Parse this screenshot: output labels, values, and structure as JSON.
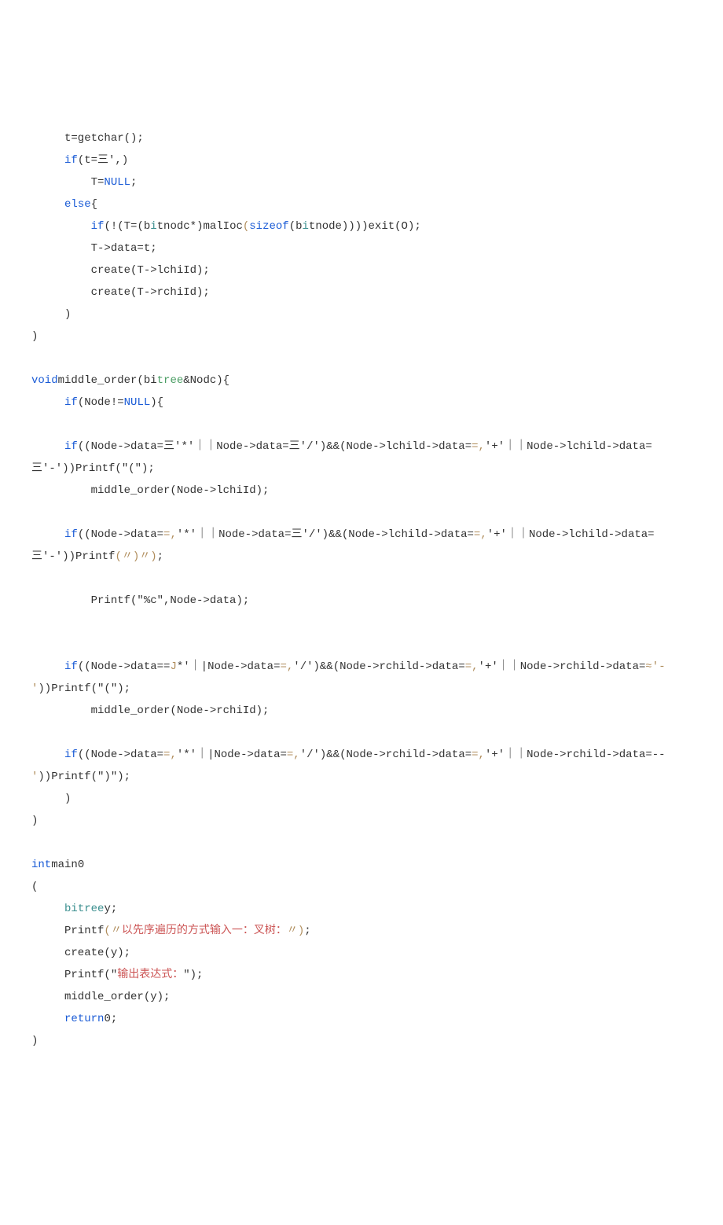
{
  "lines": {
    "l1": "     t=getchar();",
    "l2a": "     ",
    "l2b": "if",
    "l2c": "(t=三',)",
    "l3a": "         T=",
    "l3b": "NULL",
    "l3c": ";",
    "l4a": "     ",
    "l4b": "else",
    "l4c": "{",
    "l5a": "         ",
    "l5b": "if",
    "l5c": "(!(T=(b",
    "l5d": "i",
    "l5e": "tnodc*)malIoc",
    "l5f": "(",
    "l5g": "sizeof",
    "l5h": "(b",
    "l5i": "i",
    "l5j": "tnode))))exit(O);",
    "l6": "         T->data=t;",
    "l7": "         create(T->lchiId);",
    "l8": "         create(T->rchiId);",
    "l9": "     )",
    "l10": ")",
    "l11a": "void",
    "l11b": "middle_order(bi",
    "l11c": "tree",
    "l11d": "&Nodc){",
    "l12a": "     ",
    "l12b": "if",
    "l12c": "(Node!=",
    "l12d": "NULL",
    "l12e": "){",
    "l13a": "     ",
    "l13b": "if",
    "l13c": "((Node->data=三'*'｜｜Node->data=三'/')&&(Node->lchild->data=",
    "l13d": "=,",
    "l13e": "'+'｜｜Node->lchild->data=",
    "l14a": "三'-'",
    "l14b": "))Printf(\"(\");",
    "l15": "         middle_order(Node->lchiId);",
    "l16a": "     ",
    "l16b": "if",
    "l16c": "((Node->data=",
    "l16d": "=,",
    "l16e": "'*'｜｜Node->data=三'/')&&(Node->lchild->data=",
    "l16f": "=,",
    "l16g": "'+'｜｜Node->lchild->data=",
    "l17a": "三'-'",
    "l17b": "))Printf",
    "l17c": "(〃)〃)",
    "l17d": ";",
    "l18": "         Printf(\"%c\",Node->data);",
    "l19a": "     ",
    "l19b": "if",
    "l19c": "((Node->data==",
    "l19d": "J",
    "l19e": "*'｜|Node->data=",
    "l19f": "=,",
    "l19g": "'/')&&(Node->rchild->data=",
    "l19h": "=,",
    "l19i": "'+'｜｜Node->rchild->data=",
    "l19j": "≈'-",
    "l20a": "'",
    "l20b": "))Printf(\"(\");",
    "l21": "         middle_order(Node->rchiId);",
    "l22a": "     ",
    "l22b": "if",
    "l22c": "((Node->data=",
    "l22d": "=,",
    "l22e": "'*'｜|Node->data=",
    "l22f": "=,",
    "l22g": "'/')&&(Node->rchild->data=",
    "l22h": "=,",
    "l22i": "'+'｜｜Node->rchild->data=--",
    "l23a": "'",
    "l23b": "))Printf(\")\");",
    "l24": "     )",
    "l25": ")",
    "l26a": "int",
    "l26b": "main0",
    "l27": "(",
    "l28a": "     ",
    "l28b": "bitree",
    "l28c": "y;",
    "l29a": "     Printf",
    "l29b": "(〃",
    "l29c": "以先序遍历的方式输入一：叉树：",
    "l29d": "〃)",
    "l29e": ";",
    "l30": "     create(y);",
    "l31a": "     Printf(\"",
    "l31b": "输出表达式：",
    "l31c": "\");",
    "l32": "     middle_order(y);",
    "l33a": "     ",
    "l33b": "return",
    "l33c": "0;",
    "l34": ")"
  }
}
